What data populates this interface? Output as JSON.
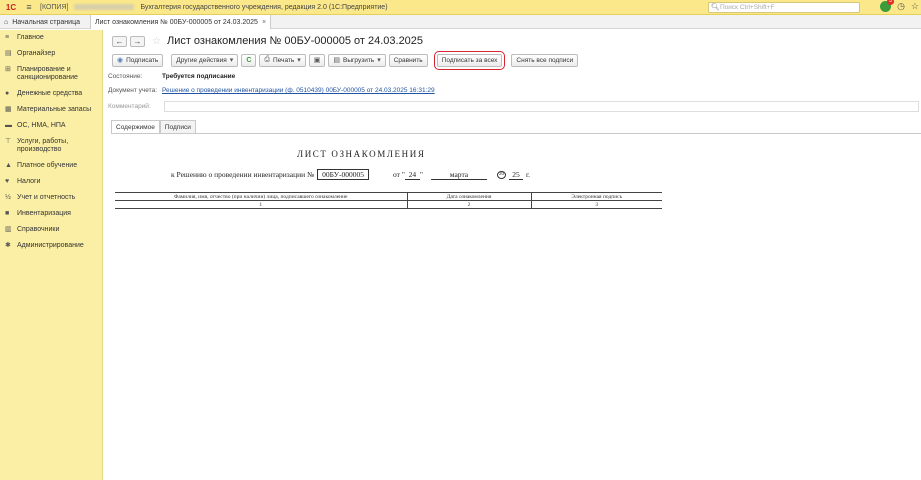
{
  "titlebar": {
    "logo": "1С",
    "copy_tag": "[КОПИЯ]",
    "app_title": "Бухгалтерия государственного учреждения, редакция 2.0  (1С:Предприятие)",
    "search_placeholder": "Поиск Ctrl+Shift+F",
    "notification_count": "3"
  },
  "tabs": {
    "home": "Начальная страница",
    "doc": "Лист ознакомления № 00БУ-000005 от 24.03.2025"
  },
  "sidebar": {
    "items": [
      {
        "label": "Главное",
        "icon": "menu-icon"
      },
      {
        "label": "Органайзер",
        "icon": "organizer-icon"
      },
      {
        "label": "Планирование и санкционирование",
        "icon": "planning-icon"
      },
      {
        "label": "Денежные средства",
        "icon": "money-icon"
      },
      {
        "label": "Материальные запасы",
        "icon": "inventory-icon"
      },
      {
        "label": "ОС, НМА, НПА",
        "icon": "assets-icon"
      },
      {
        "label": "Услуги, работы, производство",
        "icon": "services-icon"
      },
      {
        "label": "Платное обучение",
        "icon": "education-icon"
      },
      {
        "label": "Налоги",
        "icon": "taxes-icon"
      },
      {
        "label": "Учет и отчетность",
        "icon": "reports-icon"
      },
      {
        "label": "Инвентаризация",
        "icon": "inventory-count-icon"
      },
      {
        "label": "Справочники",
        "icon": "catalogs-icon"
      },
      {
        "label": "Администрирование",
        "icon": "admin-icon"
      }
    ]
  },
  "document": {
    "title": "Лист ознакомления № 00БУ-000005 от 24.03.2025",
    "toolbar": {
      "sign": "Подписать",
      "other_actions": "Другие действия",
      "print": "Печать",
      "export": "Выгрузить",
      "compare": "Сравнить",
      "sign_for_all": "Подписать за всех",
      "remove_signatures": "Снять все подписи"
    },
    "state_label": "Состояние:",
    "state_value": "Требуется подписание",
    "doc_label": "Документ учета:",
    "doc_link": "Решение о проведении инвентаризации (ф. 0510439) 00БУ-000005 от 24.03.2025 16:31:29",
    "comment_label": "Комментарий:",
    "comment_value": "",
    "inner_tabs": [
      "Содержимое",
      "Подписи"
    ]
  },
  "form": {
    "title": "ЛИСТ ОЗНАКОМЛЕНИЯ",
    "decision_text": "к Решению о проведении инвентаризации №",
    "number": "00БУ-000005",
    "from_text": "от \"",
    "day": "24",
    "quote_close": "\"",
    "month": "марта",
    "year_prefix": "20",
    "year": "25",
    "year_suffix": "г.",
    "columns": [
      "Фамилия, имя, отчество (при наличии) лица, подписавшего ознакомление",
      "Дата ознакомления",
      "Электронная подпись"
    ],
    "column_numbers": [
      "1",
      "2",
      "3"
    ]
  }
}
